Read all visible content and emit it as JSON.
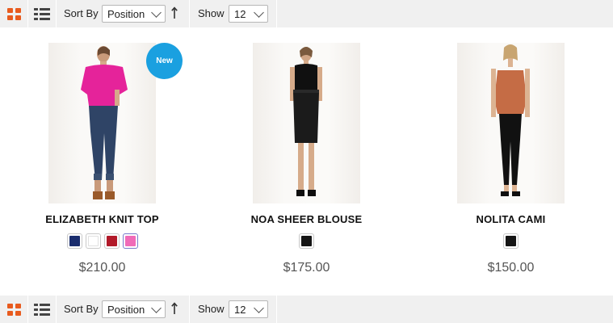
{
  "toolbars": {
    "sort_label": "Sort By",
    "sort_value": "Position",
    "show_label": "Show",
    "show_value": "12",
    "grid_icon_color": "#e85b1e",
    "list_icon_color": "#444444"
  },
  "products": [
    {
      "name": "ELIZABETH KNIT TOP",
      "price": "$210.00",
      "badge": "New",
      "image": "model-pink-knit-top-jeans",
      "swatches": [
        {
          "color": "#1a2d6e",
          "selected": false
        },
        {
          "color": "#ffffff",
          "selected": false
        },
        {
          "color": "#b21a2a",
          "selected": false
        },
        {
          "color": "#f06ab8",
          "selected": true
        }
      ]
    },
    {
      "name": "NOA SHEER BLOUSE",
      "price": "$175.00",
      "badge": "",
      "image": "model-black-sleeveless-blouse-skirt",
      "swatches": [
        {
          "color": "#151515",
          "selected": false
        }
      ]
    },
    {
      "name": "NOLITA CAMI",
      "price": "$150.00",
      "badge": "",
      "image": "model-rust-cami-black-pants",
      "swatches": [
        {
          "color": "#151515",
          "selected": false
        }
      ]
    }
  ]
}
